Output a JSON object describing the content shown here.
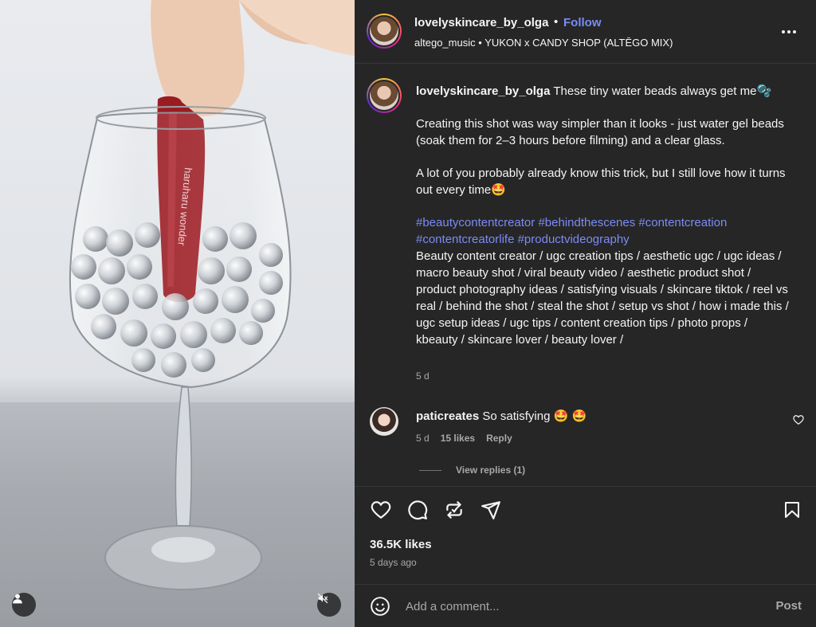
{
  "post": {
    "username": "lovelyskincare_by_olga",
    "follow_label": "Follow",
    "separator": "•",
    "audio": {
      "artist": "altego_music",
      "sep": "•",
      "track": "YUKON x CANDY SHOP (ALTĒGO MIX)"
    },
    "media": {
      "product_text": "haruharu wonder",
      "buttons": {
        "tagged_users_icon": "person-icon",
        "mute_icon": "speaker-muted-icon"
      }
    }
  },
  "caption": {
    "username": "lovelyskincare_by_olga",
    "line1": "These tiny water beads always get me🫧",
    "para2": "Creating this shot was way simpler than it looks - just water gel beads (soak them for 2–3 hours before filming) and a clear glass.",
    "para3": "A lot of you probably already know this trick, but I still love how it turns out every time🤩",
    "hashtags": [
      "#beautycontentcreator",
      "#behindthescenes",
      "#contentcreation",
      "#contentcreatorlife",
      "#productvideography"
    ],
    "keywords": "Beauty content creator / ugc creation tips / aesthetic ugc / ugc ideas / macro beauty shot / viral beauty video / aesthetic product shot / product photography ideas / satisfying visuals / skincare tiktok / reel vs real / behind the shot / steal the shot / setup vs shot / how i made this / ugc setup ideas / ugc tips / content creation tips / photo props / kbeauty / skincare lover / beauty lover /",
    "time": "5 d"
  },
  "comments": [
    {
      "username": "paticreates",
      "text": "So satisfying 🤩 🤩",
      "time": "5 d",
      "likes": "15 likes",
      "reply_label": "Reply",
      "view_replies": "View replies (1)"
    }
  ],
  "actions": {
    "like_icon": "heart-icon",
    "comment_icon": "comment-icon",
    "repost_icon": "repost-icon",
    "share_icon": "send-icon",
    "save_icon": "bookmark-icon"
  },
  "stats": {
    "likes": "36.5K likes",
    "posted": "5 days ago"
  },
  "composer": {
    "placeholder": "Add a comment...",
    "post_label": "Post"
  },
  "colors": {
    "panel_bg": "#262626",
    "link_blue": "#7b8cf5",
    "muted": "#a8a8a8",
    "product_red": "#9b1b22"
  }
}
